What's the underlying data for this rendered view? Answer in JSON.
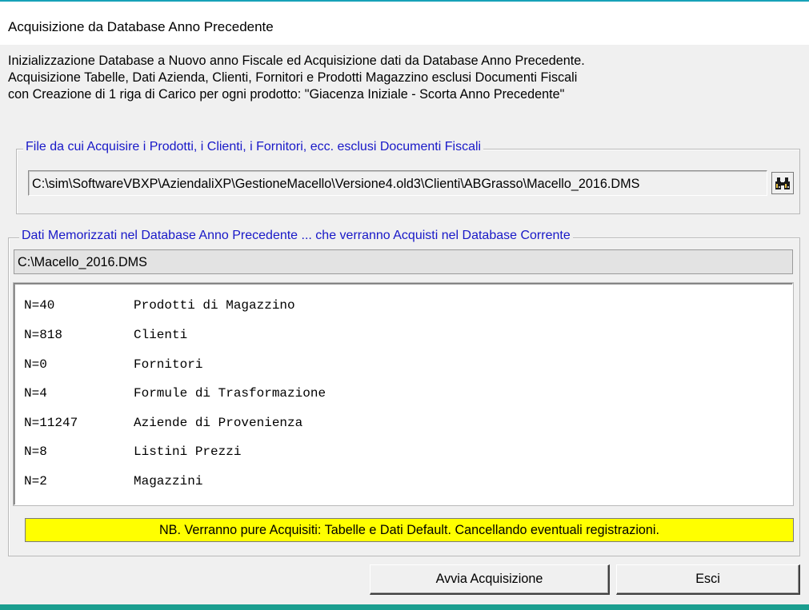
{
  "window": {
    "title": "Acquisizione da Database Anno Precedente"
  },
  "description": {
    "lines": [
      "Inizializzazione Database a Nuovo anno Fiscale ed Acquisizione dati da Database Anno Precedente.",
      "Acquisizione Tabelle, Dati Azienda, Clienti, Fornitori e Prodotti Magazzino esclusi Documenti Fiscali",
      "con Creazione di 1 riga di Carico per ogni prodotto: \"Giacenza Iniziale - Scorta Anno Precedente\""
    ]
  },
  "source_group": {
    "legend": "File da cui Acquisire i Prodotti, i Clienti, i Fornitori, ecc. esclusi Documenti Fiscali",
    "path_value": "C:\\sim\\SoftwareVBXP\\AziendaliXP\\GestioneMacello\\Versione4.old3\\Clienti\\ABGrasso\\Macello_2016.DMS",
    "browse_icon": "binoculars-icon"
  },
  "data_group": {
    "legend": "Dati Memorizzati nel Database Anno Precedente ... che verranno Acquisti nel Database Corrente",
    "database_name": "C:\\Macello_2016.DMS",
    "items": [
      {
        "count": "N=40",
        "label": "Prodotti di Magazzino"
      },
      {
        "count": "N=818",
        "label": "Clienti"
      },
      {
        "count": "N=0",
        "label": "Fornitori"
      },
      {
        "count": "N=4",
        "label": "Formule di Trasformazione"
      },
      {
        "count": "N=11247",
        "label": "Aziende di Provenienza"
      },
      {
        "count": "N=8",
        "label": "Listini Prezzi"
      },
      {
        "count": "N=2",
        "label": "Magazzini"
      }
    ],
    "warning": "NB. Verranno pure Acquisiti: Tabelle e Dati Default. Cancellando eventuali registrazioni."
  },
  "buttons": {
    "start_label": "Avvia Acquisizione",
    "exit_label": "Esci"
  },
  "colors": {
    "legend_text": "#1818c8",
    "warning_background": "#ffff00",
    "accent": "#17a2b8"
  }
}
